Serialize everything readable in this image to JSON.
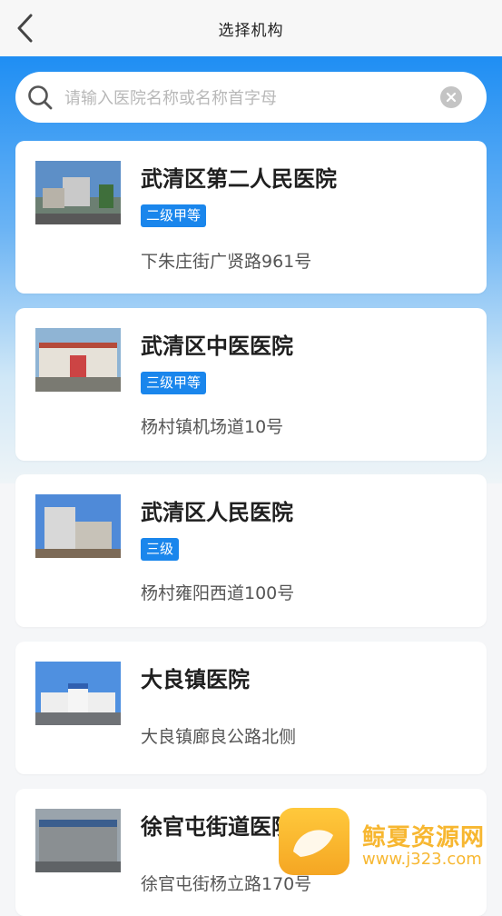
{
  "header": {
    "title": "选择机构",
    "back_icon": "chevron-left-icon"
  },
  "search": {
    "placeholder": "请输入医院名称或名称首字母",
    "value": "",
    "icon": "search-icon",
    "clear_icon": "clear-icon"
  },
  "hospitals": [
    {
      "name": "武清区第二人民医院",
      "level": "二级甲等",
      "address": "下朱庄街广贤路961号"
    },
    {
      "name": "武清区中医医院",
      "level": "三级甲等",
      "address": "杨村镇机场道10号"
    },
    {
      "name": "武清区人民医院",
      "level": "三级",
      "address": "杨村雍阳西道100号"
    },
    {
      "name": "大良镇医院",
      "level": "",
      "address": "大良镇廊良公路北侧"
    },
    {
      "name": "徐官屯街道医院",
      "level": "",
      "address": "徐官屯街杨立路170号"
    }
  ],
  "watermark": {
    "brand": "鲸夏资源网",
    "url": "www.j323.com"
  },
  "colors": {
    "accent": "#1a86ec",
    "hero_top": "#1f8ef3"
  }
}
